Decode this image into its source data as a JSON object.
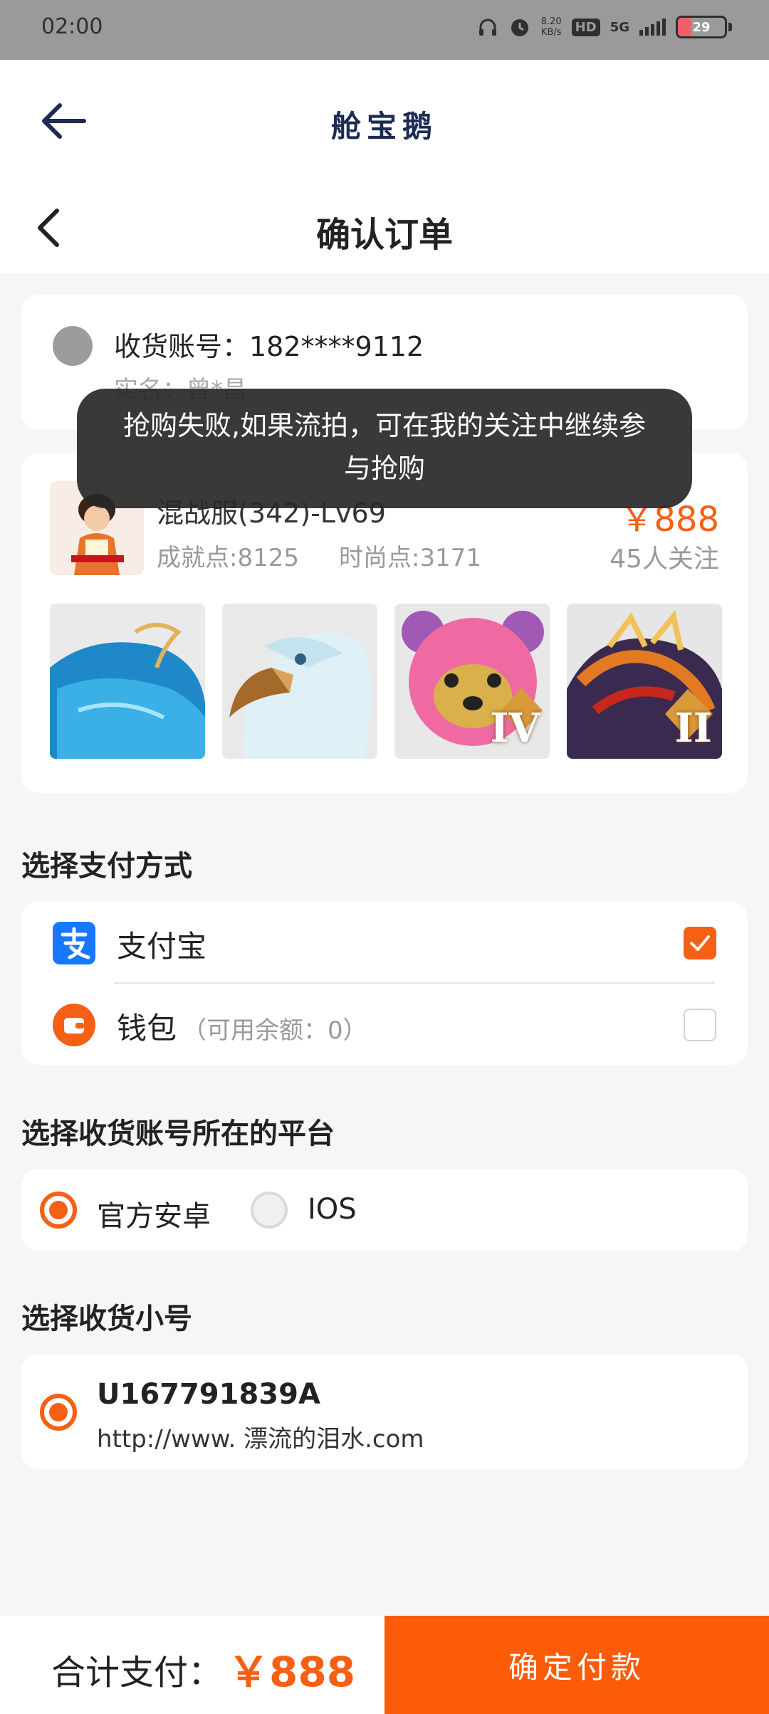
{
  "status_bar": {
    "time": "02:00",
    "net_speed_value": "8.20",
    "net_speed_unit": "KB/s",
    "hd": "HD",
    "network": "5G",
    "battery": "29",
    "battery_level": 0.29,
    "icons": [
      "headphones-icon",
      "alarm-icon",
      "signal-icon",
      "battery-icon"
    ]
  },
  "app_bar": {
    "title": "舱宝鹅"
  },
  "nav": {
    "title": "确认订单"
  },
  "account": {
    "label": "收货账号：182****9112",
    "realname": "实名：曾*昌"
  },
  "product": {
    "name": "混战服(342)-Lv69",
    "price": "￥888",
    "achievement": "成就点:8125",
    "fashion": "时尚点:3171",
    "followers": "45人关注",
    "thumbnails": [
      {
        "name": "blue-whale-mount",
        "badge": ""
      },
      {
        "name": "white-eagle",
        "badge": ""
      },
      {
        "name": "pink-bear-pet",
        "badge": "IV"
      },
      {
        "name": "dragon-mount",
        "badge": "II"
      }
    ]
  },
  "payment": {
    "section_title": "选择支付方式",
    "options": [
      {
        "label": "支付宝",
        "sub": "",
        "checked": true,
        "icon": "alipay-icon"
      },
      {
        "label": "钱包",
        "sub": "（可用余额：0）",
        "checked": false,
        "icon": "wallet-icon"
      }
    ]
  },
  "platform": {
    "section_title": "选择收货账号所在的平台",
    "options": [
      {
        "label": "官方安卓",
        "selected": true
      },
      {
        "label": "IOS",
        "selected": false
      }
    ]
  },
  "sub_account": {
    "section_title": "选择收货小号",
    "id": "U167791839A",
    "url": "http://www. 漂流的泪水.com",
    "selected": true
  },
  "bottom": {
    "total_label": "合计支付：",
    "total_amount": "￥888",
    "pay_button": "确定付款"
  },
  "toast": {
    "message": "抢购失败,如果流拍，可在我的关注中继续参与抢购"
  },
  "colors": {
    "accent": "#f56015",
    "pay_button": "#fc5b08",
    "alipay": "#1677ff",
    "title_navy": "#1d2b53",
    "statusbar": "#9a9a9a"
  }
}
